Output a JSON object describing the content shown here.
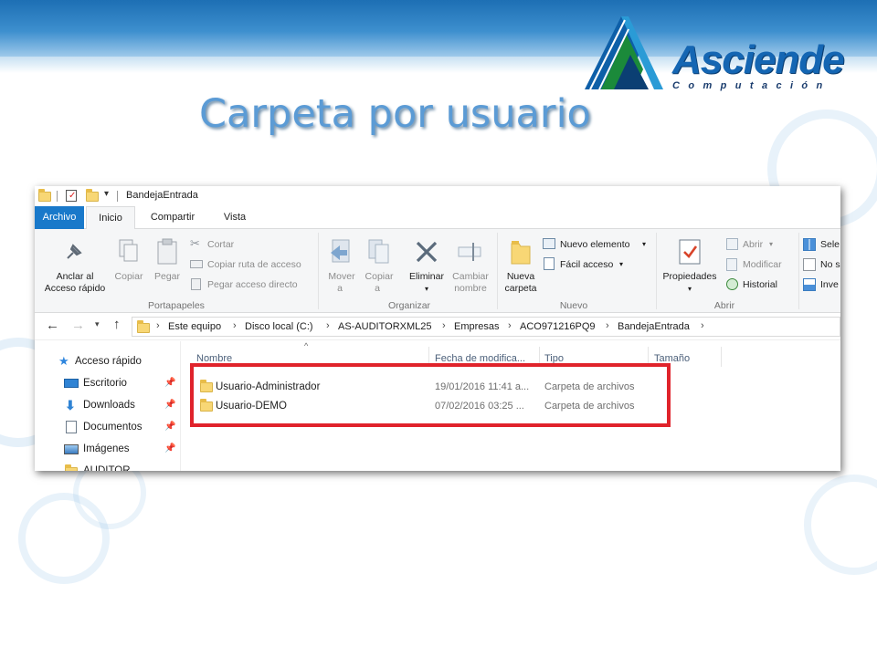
{
  "slide": {
    "title": "Carpeta por usuario",
    "logo": {
      "word": "Asciende",
      "tagline": "Computación"
    },
    "colors": {
      "title": "#5b9bd5",
      "banner": "#1d6fb4",
      "highlight": "#e0232b",
      "file_tab": "#1979ca"
    }
  },
  "explorer": {
    "window_title": "BandejaEntrada",
    "tabs": [
      "Archivo",
      "Inicio",
      "Compartir",
      "Vista"
    ],
    "active_tab": "Inicio",
    "ribbon": {
      "portapapeles": {
        "label": "Portapapeles",
        "anclar": [
          "Anclar al",
          "Acceso rápido"
        ],
        "copiar": "Copiar",
        "pegar": "Pegar",
        "cortar": "Cortar",
        "copiar_ruta": "Copiar ruta de acceso",
        "pegar_acceso": "Pegar acceso directo"
      },
      "organizar": {
        "label": "Organizar",
        "mover": [
          "Mover",
          "a"
        ],
        "copiar": [
          "Copiar",
          "a"
        ],
        "eliminar": "Eliminar",
        "cambiar": [
          "Cambiar",
          "nombre"
        ]
      },
      "nuevo": {
        "label": "Nuevo",
        "nueva_carpeta": [
          "Nueva",
          "carpeta"
        ],
        "nuevo_elemento": "Nuevo elemento",
        "facil_acceso": "Fácil acceso"
      },
      "abrir": {
        "label": "Abrir",
        "propiedades": "Propiedades",
        "abrir": "Abrir",
        "modificar": "Modificar",
        "historial": "Historial"
      },
      "seleccionar": {
        "items": [
          "Sele",
          "No s",
          "Inve"
        ]
      }
    },
    "address": {
      "path": [
        "Este equipo",
        "Disco local (C:)",
        "AS-AUDITORXML25",
        "Empresas",
        "ACO971216PQ9",
        "BandejaEntrada"
      ]
    },
    "nav": {
      "items": [
        {
          "label": "Acceso rápido",
          "icon": "star-icon"
        },
        {
          "label": "Escritorio",
          "icon": "desktop-icon",
          "pinned": true
        },
        {
          "label": "Downloads",
          "icon": "download-icon",
          "pinned": true
        },
        {
          "label": "Documentos",
          "icon": "documents-icon",
          "pinned": true
        },
        {
          "label": "Imágenes",
          "icon": "pictures-icon",
          "pinned": true
        },
        {
          "label": "AUDITOR",
          "icon": "folder-icon"
        }
      ]
    },
    "columns": [
      "Nombre",
      "Fecha de modifica...",
      "Tipo",
      "Tamaño"
    ],
    "files": [
      {
        "name": "Usuario-Administrador",
        "date": "19/01/2016 11:41 a...",
        "type": "Carpeta de archivos",
        "size": ""
      },
      {
        "name": "Usuario-DEMO",
        "date": "07/02/2016 03:25 ...",
        "type": "Carpeta de archivos",
        "size": ""
      }
    ]
  }
}
